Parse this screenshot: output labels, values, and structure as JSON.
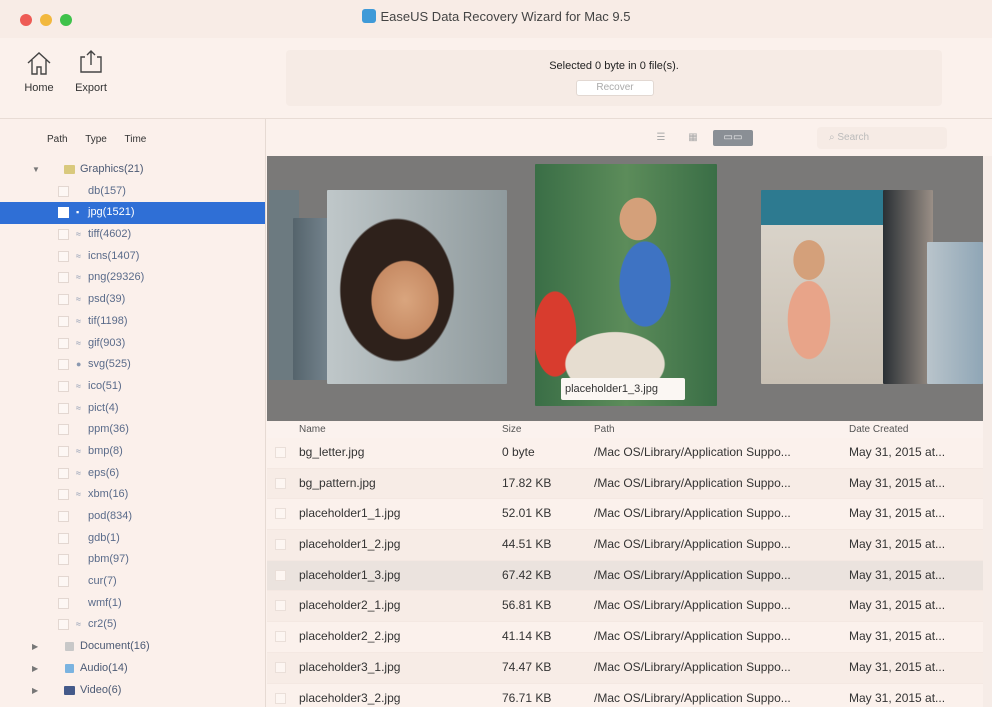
{
  "window": {
    "title": "EaseUS Data Recovery Wizard for Mac 9.5"
  },
  "toolbar": {
    "home_label": "Home",
    "export_label": "Export"
  },
  "status": {
    "text": "Selected 0 byte in 0 file(s).",
    "recover_label": "Recover"
  },
  "sidebar": {
    "tabs": [
      "Path",
      "Type",
      "Time"
    ],
    "graphics_label": "Graphics(21)",
    "items": [
      {
        "label": "db(157)",
        "glyph": ""
      },
      {
        "label": "jpg(1521)",
        "glyph": "▪",
        "selected": true
      },
      {
        "label": "tiff(4602)",
        "glyph": "≈"
      },
      {
        "label": "icns(1407)",
        "glyph": "≈"
      },
      {
        "label": "png(29326)",
        "glyph": "≈"
      },
      {
        "label": "psd(39)",
        "glyph": "≈"
      },
      {
        "label": "tif(1198)",
        "glyph": "≈"
      },
      {
        "label": "gif(903)",
        "glyph": "≈"
      },
      {
        "label": "svg(525)",
        "glyph": "●"
      },
      {
        "label": "ico(51)",
        "glyph": "≈"
      },
      {
        "label": "pict(4)",
        "glyph": "≈"
      },
      {
        "label": "ppm(36)",
        "glyph": ""
      },
      {
        "label": "bmp(8)",
        "glyph": "≈"
      },
      {
        "label": "eps(6)",
        "glyph": "≈"
      },
      {
        "label": "xbm(16)",
        "glyph": "≈"
      },
      {
        "label": "pod(834)",
        "glyph": ""
      },
      {
        "label": "gdb(1)",
        "glyph": ""
      },
      {
        "label": "pbm(97)",
        "glyph": ""
      },
      {
        "label": "cur(7)",
        "glyph": ""
      },
      {
        "label": "wmf(1)",
        "glyph": ""
      },
      {
        "label": "cr2(5)",
        "glyph": "≈"
      }
    ],
    "document_label": "Document(16)",
    "audio_label": "Audio(14)",
    "video_label": "Video(6)"
  },
  "view": {
    "search_placeholder": "Search"
  },
  "cover": {
    "caption": "placeholder1_3.jpg"
  },
  "table": {
    "headers": {
      "name": "Name",
      "size": "Size",
      "path": "Path",
      "date": "Date Created"
    },
    "rows": [
      {
        "name": "bg_letter.jpg",
        "size": "0 byte",
        "path": "/Mac OS/Library/Application Suppo...",
        "date": "May 31, 2015 at..."
      },
      {
        "name": "bg_pattern.jpg",
        "size": "17.82 KB",
        "path": "/Mac OS/Library/Application Suppo...",
        "date": "May 31, 2015 at..."
      },
      {
        "name": "placeholder1_1.jpg",
        "size": "52.01 KB",
        "path": "/Mac OS/Library/Application Suppo...",
        "date": "May 31, 2015 at..."
      },
      {
        "name": "placeholder1_2.jpg",
        "size": "44.51 KB",
        "path": "/Mac OS/Library/Application Suppo...",
        "date": "May 31, 2015 at..."
      },
      {
        "name": "placeholder1_3.jpg",
        "size": "67.42 KB",
        "path": "/Mac OS/Library/Application Suppo...",
        "date": "May 31, 2015 at..."
      },
      {
        "name": "placeholder2_1.jpg",
        "size": "56.81 KB",
        "path": "/Mac OS/Library/Application Suppo...",
        "date": "May 31, 2015 at..."
      },
      {
        "name": "placeholder2_2.jpg",
        "size": "41.14 KB",
        "path": "/Mac OS/Library/Application Suppo...",
        "date": "May 31, 2015 at..."
      },
      {
        "name": "placeholder3_1.jpg",
        "size": "74.47 KB",
        "path": "/Mac OS/Library/Application Suppo...",
        "date": "May 31, 2015 at..."
      },
      {
        "name": "placeholder3_2.jpg",
        "size": "76.71 KB",
        "path": "/Mac OS/Library/Application Suppo...",
        "date": "May 31, 2015 at..."
      }
    ]
  },
  "colors": {
    "selection": "#2f6fd6",
    "background": "#fbf1ec",
    "cover_background": "#7a7978"
  }
}
